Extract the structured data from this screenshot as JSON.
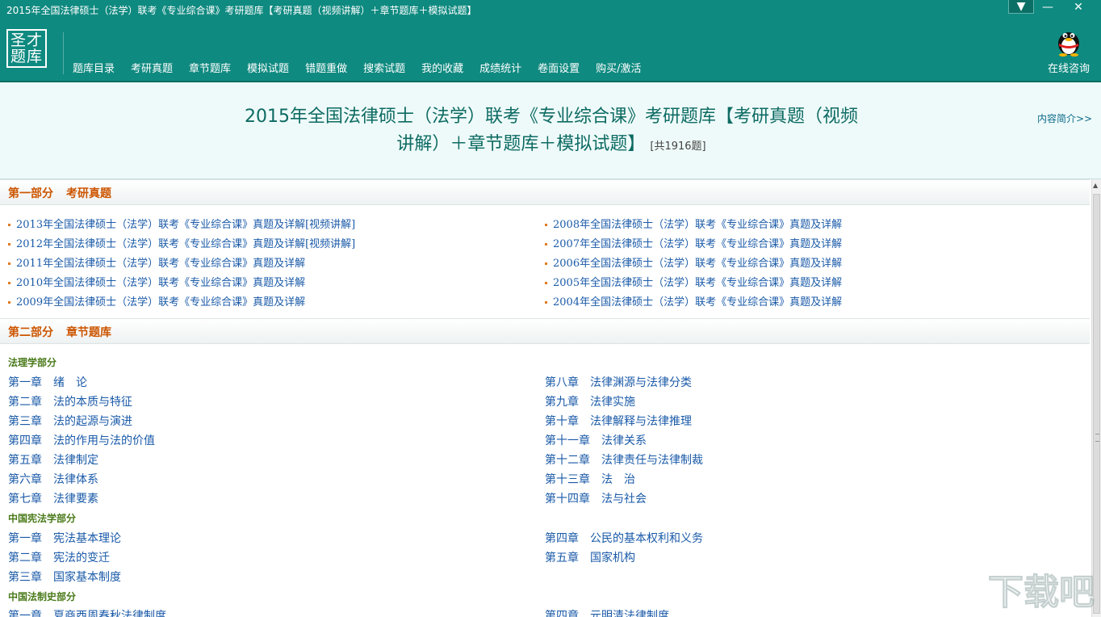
{
  "window": {
    "title": "2015年全国法律硕士（法学）联考《专业综合课》考研题库【考研真题（视频讲解）＋章节题库＋模拟试题】",
    "controls": {
      "menu": "▼",
      "minimize": "—",
      "close": "✕"
    }
  },
  "logo": {
    "lines": [
      "圣才",
      "题库"
    ]
  },
  "nav": [
    "题库目录",
    "考研真题",
    "章节题库",
    "模拟试题",
    "错题重做",
    "搜索试题",
    "我的收藏",
    "成绩统计",
    "卷面设置",
    "购买/激活"
  ],
  "consult": {
    "label": "在线咨询",
    "icon": "qq-penguin-icon"
  },
  "header": {
    "title": "2015年全国法律硕士（法学）联考《专业综合课》考研题库【考研真题（视频讲解）＋章节题库＋模拟试题】",
    "count": "[共1916题]",
    "intro_link": "内容简介>>"
  },
  "part1": {
    "label": "第一部分",
    "name": "考研真题",
    "left": [
      "2013年全国法律硕士（法学）联考《专业综合课》真题及详解[视频讲解]",
      "2012年全国法律硕士（法学）联考《专业综合课》真题及详解[视频讲解]",
      "2011年全国法律硕士（法学）联考《专业综合课》真题及详解",
      "2010年全国法律硕士（法学）联考《专业综合课》真题及详解",
      "2009年全国法律硕士（法学）联考《专业综合课》真题及详解"
    ],
    "right": [
      "2008年全国法律硕士（法学）联考《专业综合课》真题及详解",
      "2007年全国法律硕士（法学）联考《专业综合课》真题及详解",
      "2006年全国法律硕士（法学）联考《专业综合课》真题及详解",
      "2005年全国法律硕士（法学）联考《专业综合课》真题及详解",
      "2004年全国法律硕士（法学）联考《专业综合课》真题及详解"
    ]
  },
  "part2": {
    "label": "第二部分",
    "name": "章节题库",
    "sections": [
      {
        "title": "法理学部分",
        "left": [
          {
            "no": "第一章",
            "name": "绪　论"
          },
          {
            "no": "第二章",
            "name": "法的本质与特征"
          },
          {
            "no": "第三章",
            "name": "法的起源与演进"
          },
          {
            "no": "第四章",
            "name": "法的作用与法的价值"
          },
          {
            "no": "第五章",
            "name": "法律制定"
          },
          {
            "no": "第六章",
            "name": "法律体系"
          },
          {
            "no": "第七章",
            "name": "法律要素"
          }
        ],
        "right": [
          {
            "no": "第八章",
            "name": "法律渊源与法律分类"
          },
          {
            "no": "第九章",
            "name": "法律实施"
          },
          {
            "no": "第十章",
            "name": "法律解释与法律推理"
          },
          {
            "no": "第十一章",
            "name": "法律关系"
          },
          {
            "no": "第十二章",
            "name": "法律责任与法律制裁"
          },
          {
            "no": "第十三章",
            "name": "法　治"
          },
          {
            "no": "第十四章",
            "name": "法与社会"
          }
        ]
      },
      {
        "title": "中国宪法学部分",
        "left": [
          {
            "no": "第一章",
            "name": "宪法基本理论"
          },
          {
            "no": "第二章",
            "name": "宪法的变迁"
          },
          {
            "no": "第三章",
            "name": "国家基本制度"
          }
        ],
        "right": [
          {
            "no": "第四章",
            "name": "公民的基本权利和义务"
          },
          {
            "no": "第五章",
            "name": "国家机构"
          }
        ]
      },
      {
        "title": "中国法制史部分",
        "left": [
          {
            "no": "第一章",
            "name": "夏商西周春秋法律制度"
          }
        ],
        "right": [
          {
            "no": "第四章",
            "name": "元明清法律制度"
          }
        ]
      }
    ]
  },
  "watermark": "下载吧"
}
